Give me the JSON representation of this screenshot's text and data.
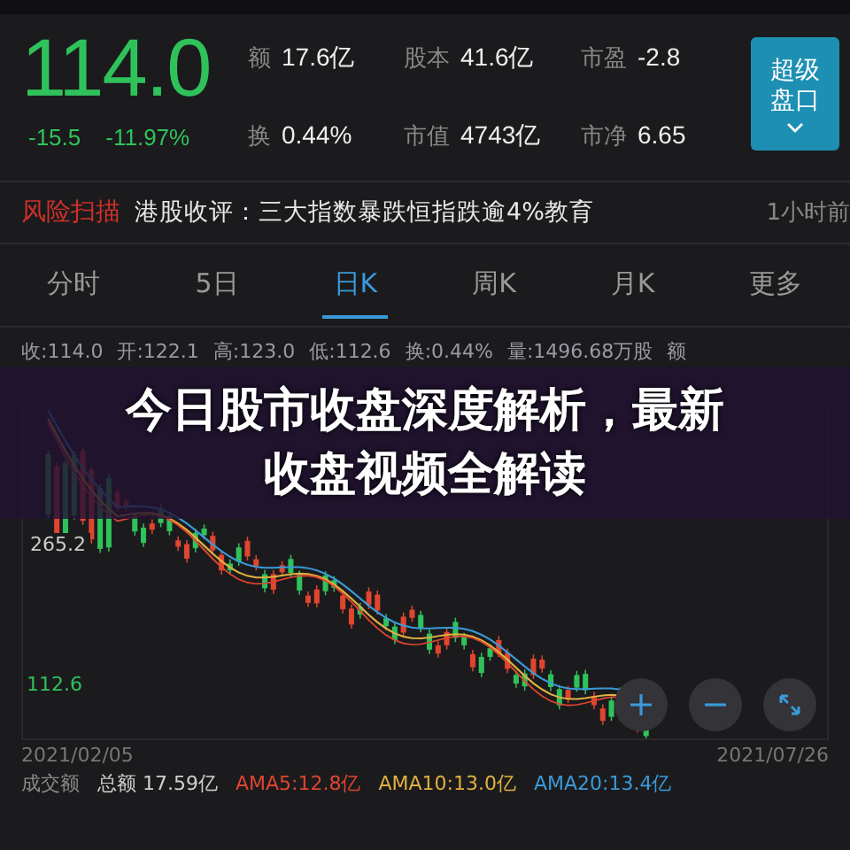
{
  "quote": {
    "price": "114.0",
    "change": "-15.5",
    "change_pct": "-11.97%"
  },
  "stats": [
    {
      "label": "额",
      "value": "17.6亿"
    },
    {
      "label": "股本",
      "value": "41.6亿"
    },
    {
      "label": "市盈",
      "value": "-2.8"
    },
    {
      "label": "换",
      "value": "0.44%"
    },
    {
      "label": "市值",
      "value": "4743亿"
    },
    {
      "label": "市净",
      "value": "6.65"
    }
  ],
  "super_button": {
    "label": "超级盘口"
  },
  "news": {
    "tag": "风险扫描",
    "headline": "港股收评：三大指数暴跌恒指跌逾4%教育",
    "time": "1小时前"
  },
  "tabs": [
    {
      "label": "分时",
      "selected": false
    },
    {
      "label": "5日",
      "selected": false
    },
    {
      "label": "日K",
      "selected": true
    },
    {
      "label": "周K",
      "selected": false
    },
    {
      "label": "月K",
      "selected": false
    },
    {
      "label": "更多",
      "selected": false
    }
  ],
  "quote_line": [
    "收:114.0",
    "开:122.1",
    "高:123.0",
    "低:112.6",
    "换:0.44%",
    "量:1496.68万股",
    "额"
  ],
  "chart": {
    "y_mid": "265.2",
    "y_low": "112.6",
    "start_date": "2021/02/05",
    "end_date": "2021/07/26"
  },
  "volume_line": [
    {
      "text": "成交额",
      "color": "#8a8a8a"
    },
    {
      "text": "总额 17.59亿",
      "color": "#d0d0d0"
    },
    {
      "text": "AMA5:12.8亿",
      "color": "#e0452f"
    },
    {
      "text": "AMA10:13.0亿",
      "color": "#e0b040"
    },
    {
      "text": "AMA20:13.4亿",
      "color": "#3a9ad9"
    }
  ],
  "headline": "今日股市收盘深度解析，最新收盘视频全解读"
}
